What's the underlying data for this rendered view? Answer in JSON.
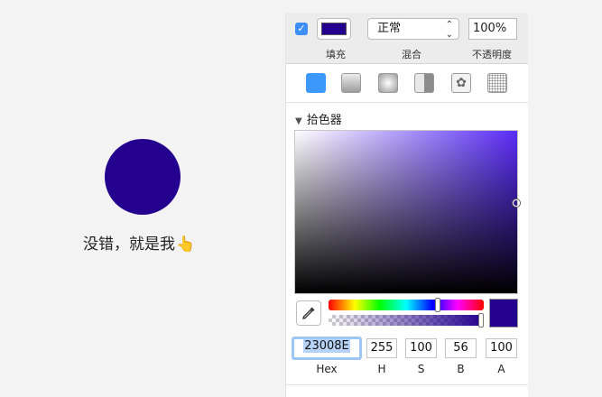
{
  "canvas": {
    "caption": "没错，就是我",
    "hand_emoji": "👆",
    "circle_color": "#23008E"
  },
  "fill": {
    "enabled": true,
    "checkbox_glyph": "✓",
    "color": "#23008E",
    "label": "填充",
    "blend_mode": "正常",
    "blend_label": "混合",
    "opacity": "100%",
    "opacity_label": "不透明度"
  },
  "fill_types": [
    {
      "name": "solid",
      "selected": true
    },
    {
      "name": "linear-gradient"
    },
    {
      "name": "radial-gradient"
    },
    {
      "name": "angular-gradient"
    },
    {
      "name": "pattern"
    },
    {
      "name": "noise"
    }
  ],
  "picker": {
    "title": "拾色器",
    "collapse_glyph": "▼",
    "hue_fraction": 0.7,
    "alpha": 1.0
  },
  "values": {
    "hex": "23008E",
    "hex_label": "Hex",
    "h": "255",
    "h_label": "H",
    "s": "100",
    "s_label": "S",
    "b": "56",
    "b_label": "B",
    "a": "100",
    "a_label": "A"
  }
}
